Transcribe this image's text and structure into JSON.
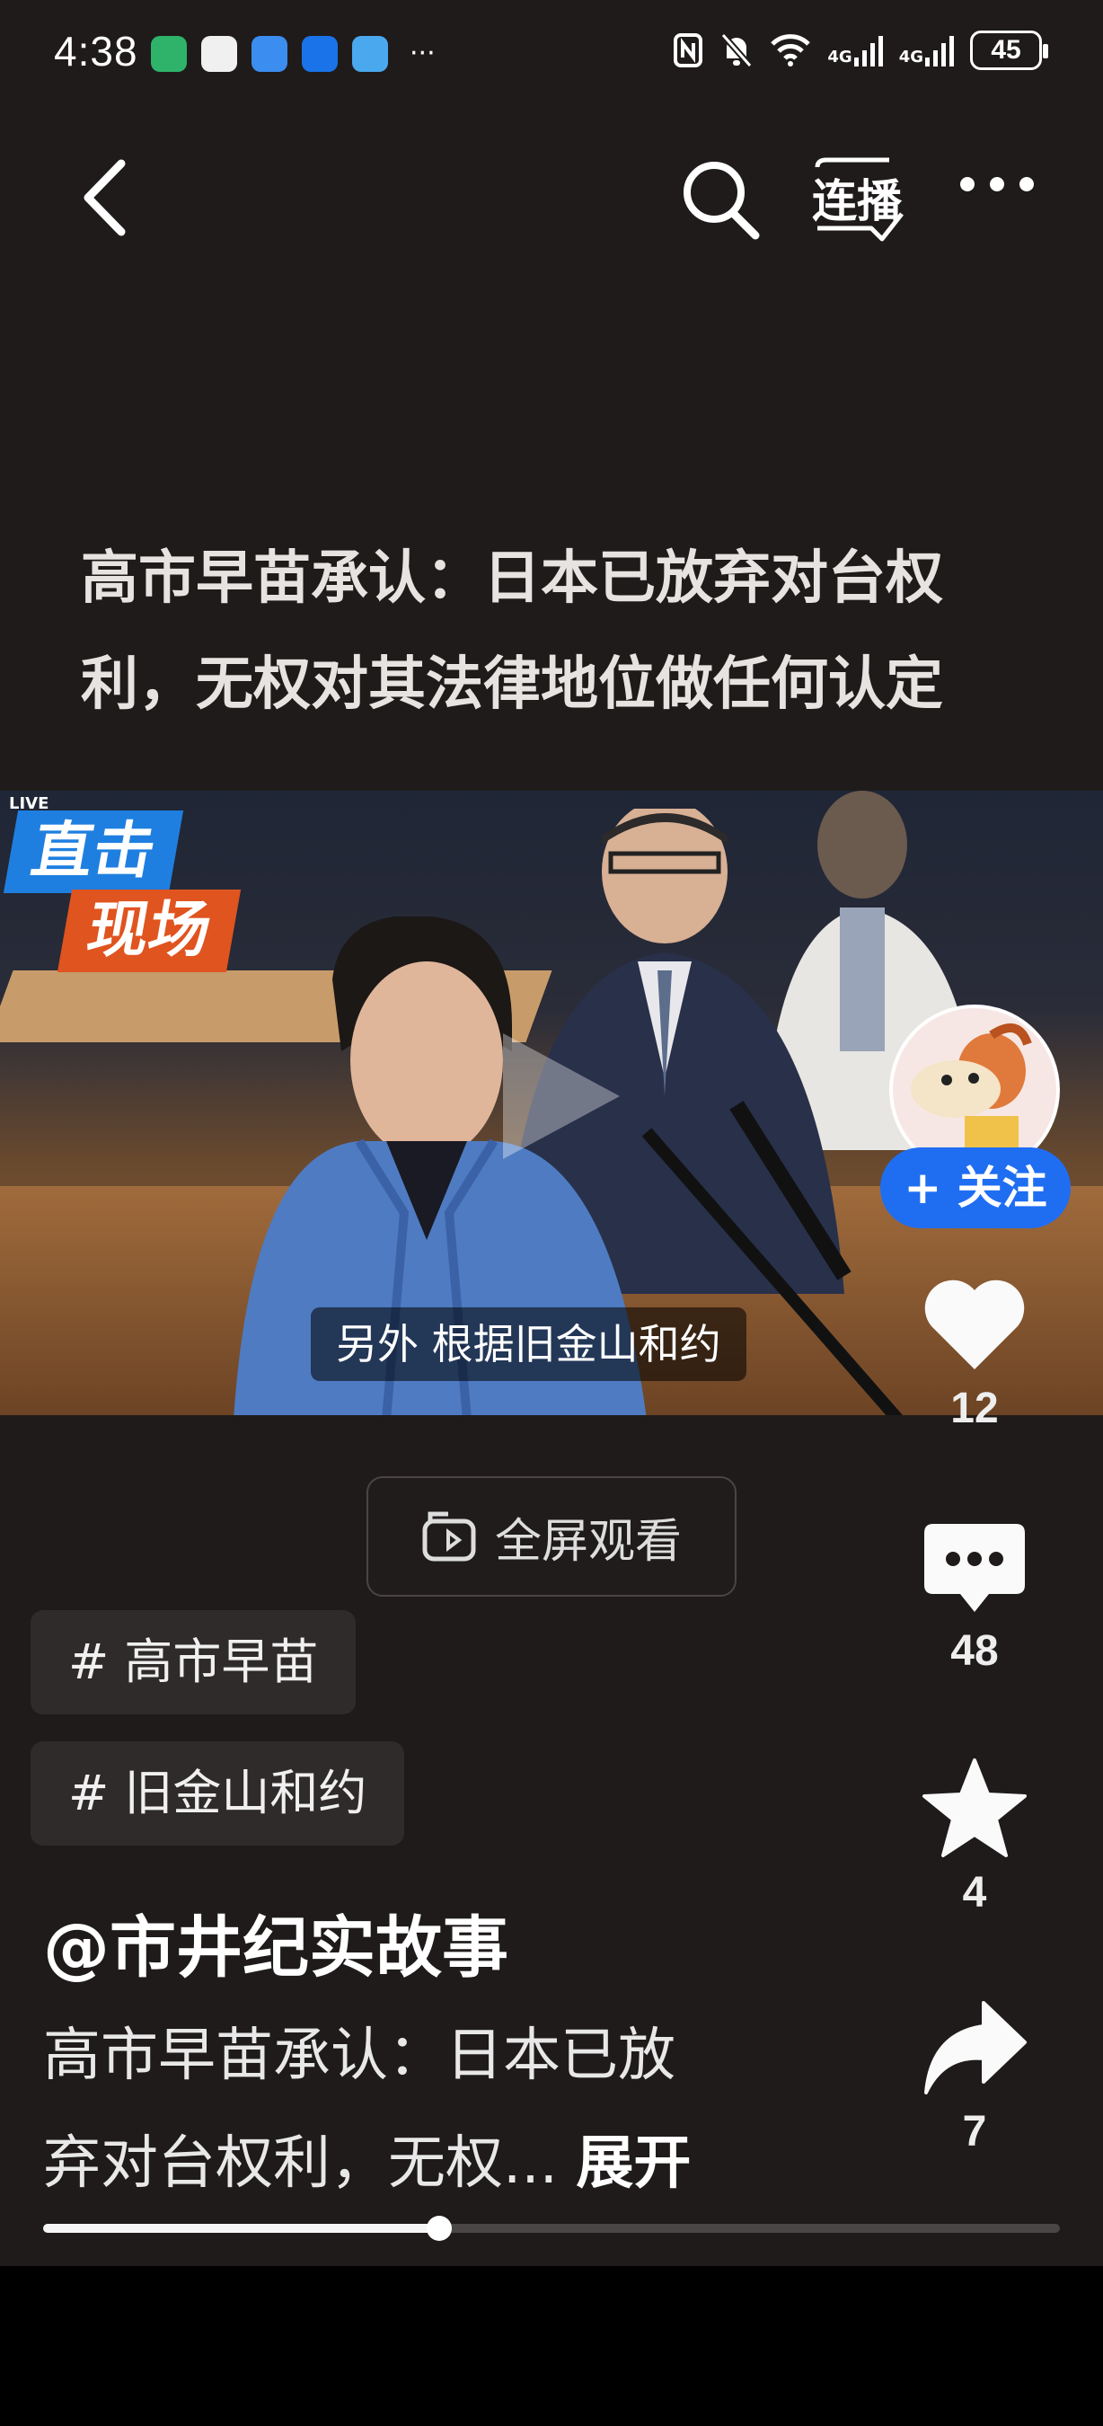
{
  "status_bar": {
    "time": "4:38",
    "battery": "45",
    "network_1": "4G",
    "network_2": "4G"
  },
  "nav": {
    "back_icon": "back-arrow-icon",
    "search_icon": "search-icon",
    "cast_label": "连播",
    "more_icon": "more-dots-icon"
  },
  "headline": {
    "line1": "高市早苗承认：日本已放弃对台权",
    "line2": "利，无权对其法律地位做任何认定"
  },
  "video": {
    "live_label": "LIVE",
    "tag_line1": "直击",
    "tag_line2": "现场",
    "subtitle": "另外 根据旧金山和约"
  },
  "actions": {
    "follow_label": "+ 关注",
    "likes": "12",
    "comments": "48",
    "favorites": "4",
    "shares": "7"
  },
  "fullscreen_label": "全屏观看",
  "hashtags": [
    "# 高市早苗",
    "# 旧金山和约"
  ],
  "author": "@市井纪实故事",
  "description": {
    "line1": "高市早苗承认：日本已放",
    "line2": "弃对台权利，无权...",
    "expand": "展开"
  },
  "progress": {
    "fraction": 0.39
  },
  "colors": {
    "accent_blue": "#1f6ef2",
    "background": "#1f1b1a"
  }
}
